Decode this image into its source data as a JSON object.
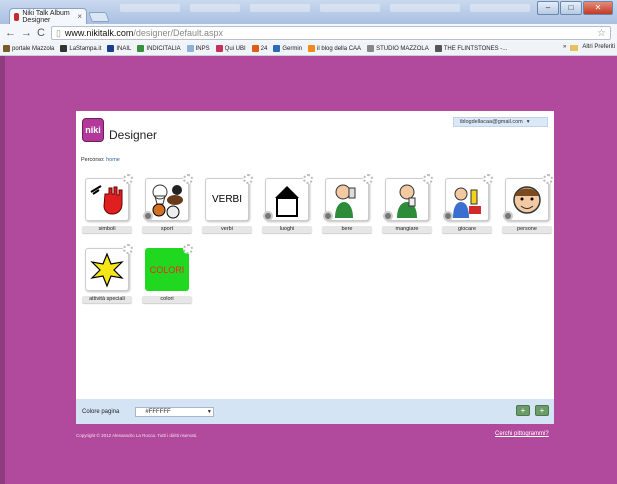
{
  "browser": {
    "tab_title": "Niki Talk Album Designer",
    "tab_close": "×",
    "url_host": "www.nikitalk.com",
    "url_path": "/designer/Default.aspx",
    "bookmarks": [
      {
        "label": "portale Mazzola",
        "color": "#7a5b2a"
      },
      {
        "label": "LaStampa.it",
        "color": "#333333"
      },
      {
        "label": "INAIL",
        "color": "#1b3f8f"
      },
      {
        "label": "INDICITALIA",
        "color": "#3a8f3a"
      },
      {
        "label": "INPS",
        "color": "#8fb0d8"
      },
      {
        "label": "Qui UBI",
        "color": "#c8325a"
      },
      {
        "label": "24",
        "color": "#e05a1a"
      },
      {
        "label": "Germin",
        "color": "#2a6bb5"
      },
      {
        "label": "il blog della CAA",
        "color": "#f08a1a"
      },
      {
        "label": "STUDIO MAZZOLA",
        "color": "#888888"
      },
      {
        "label": "THE FLINTSTONES -...",
        "color": "#555555"
      }
    ],
    "bookmarks_more": "»",
    "bookmarks_other": "Altri Preferiti"
  },
  "page": {
    "logo_text": "niki",
    "title": "Designer",
    "user_email": "iblogdellacaa@gmail.com",
    "breadcrumb_label": "Percorso:",
    "breadcrumb_link": "home",
    "tiles": [
      {
        "label": "simboli"
      },
      {
        "label": "sport"
      },
      {
        "label": "verbi",
        "picture_text": "VERBI"
      },
      {
        "label": "luoghi"
      },
      {
        "label": "bere"
      },
      {
        "label": "mangiare"
      },
      {
        "label": "giocare"
      },
      {
        "label": "persone"
      },
      {
        "label": "attività speciali"
      },
      {
        "label": "colori",
        "picture_text": "COLORI"
      }
    ],
    "footer": {
      "color_label": "Colore pagina",
      "color_value": "#FFFFFF"
    },
    "copyright": "Copyright © 2012 Alessandro La Rocca. Tutti i diritti riservati.",
    "search_link": "Cerchi pittogrammi?"
  }
}
